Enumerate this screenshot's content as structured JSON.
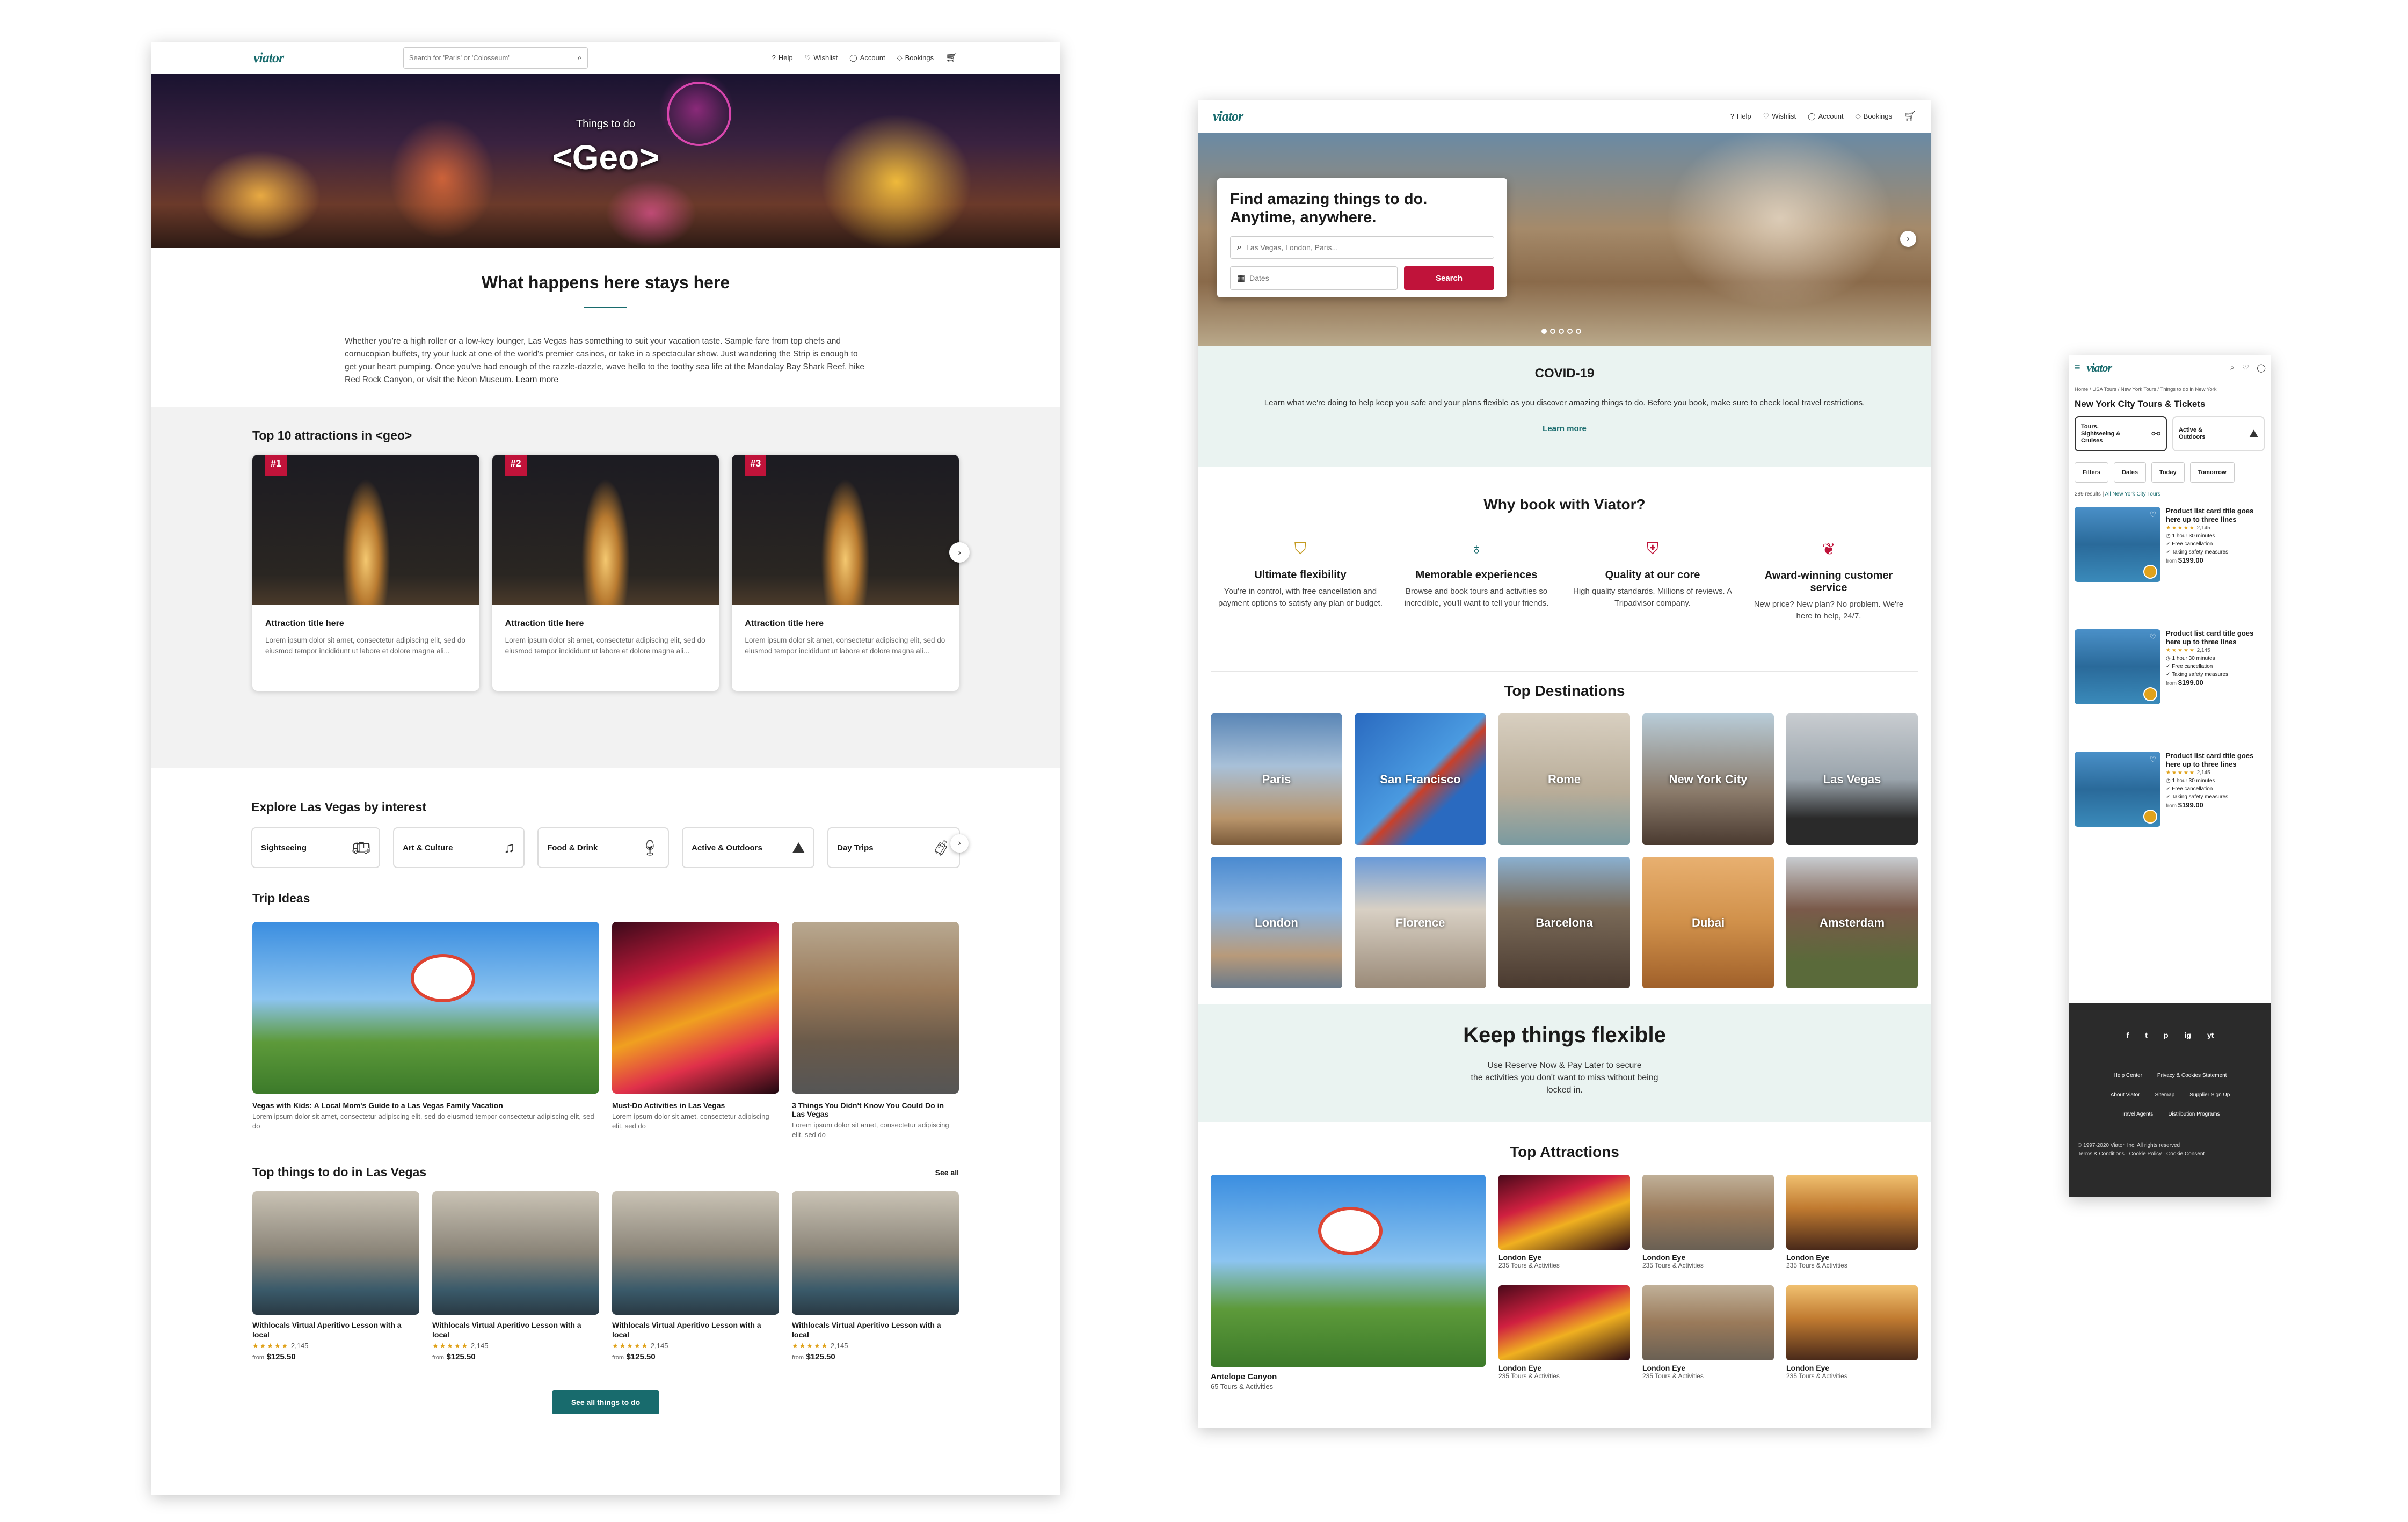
{
  "left": {
    "logo": "viator",
    "search_placeholder": "Search for 'Paris' or 'Colosseum'",
    "nav": {
      "help": "Help",
      "wishlist": "Wishlist",
      "account": "Account",
      "bookings": "Bookings"
    },
    "hero": {
      "eyebrow": "Things to do",
      "title": "<Geo>"
    },
    "intro": {
      "heading": "What happens here stays here",
      "body": "Whether you're a high roller or a low-key lounger, Las Vegas has something to suit your vacation taste. Sample fare from top chefs and cornucopian buffets, try your luck at one of the world's premier casinos, or take in a spectacular show. Just wandering the Strip is enough to get your heart pumping. Once you've had enough of the razzle-dazzle, wave hello to the toothy sea life at the Mandalay Bay Shark Reef, hike Red Rock Canyon, or visit the Neon Museum.",
      "link": "Learn more"
    },
    "top10": {
      "heading": "Top 10 attractions in <geo>",
      "cards": [
        {
          "rank": "#1",
          "title": "Attraction title here",
          "body": "Lorem ipsum dolor sit amet, consectetur adipiscing elit, sed do eiusmod tempor incididunt ut labore et dolore magna ali..."
        },
        {
          "rank": "#2",
          "title": "Attraction title here",
          "body": "Lorem ipsum dolor sit amet, consectetur adipiscing elit, sed do eiusmod tempor incididunt ut labore et dolore magna ali..."
        },
        {
          "rank": "#3",
          "title": "Attraction title here",
          "body": "Lorem ipsum dolor sit amet, consectetur adipiscing elit, sed do eiusmod tempor incididunt ut labore et dolore magna ali..."
        }
      ]
    },
    "explore": {
      "heading": "Explore Las Vegas by interest",
      "items": [
        "Sightseeing",
        "Art & Culture",
        "Food & Drink",
        "Active & Outdoors",
        "Day Trips"
      ]
    },
    "trip_ideas": {
      "heading": "Trip Ideas",
      "items": [
        {
          "title": "Vegas with Kids: A Local Mom's Guide to a Las Vegas Family Vacation",
          "body": "Lorem ipsum dolor sit amet, consectetur adipiscing elit, sed do eiusmod tempor consectetur adipiscing elit, sed do"
        },
        {
          "title": "Must-Do Activities in Las Vegas",
          "body": "Lorem ipsum dolor sit amet, consectetur adipiscing elit, sed do"
        },
        {
          "title": "3 Things You Didn't Know You Could Do in Las Vegas",
          "body": "Lorem ipsum dolor sit amet, consectetur adipiscing elit, sed do"
        }
      ]
    },
    "top_things": {
      "heading": "Top things to do in Las Vegas",
      "see_all": "See all",
      "items": [
        {
          "title": "Withlocals Virtual Aperitivo Lesson with a local",
          "stars": "★★★★★",
          "reviews": "2,145",
          "from": "from",
          "price": "$125.50"
        },
        {
          "title": "Withlocals Virtual Aperitivo Lesson with a local",
          "stars": "★★★★★",
          "reviews": "2,145",
          "from": "from",
          "price": "$125.50"
        },
        {
          "title": "Withlocals Virtual Aperitivo Lesson with a local",
          "stars": "★★★★★",
          "reviews": "2,145",
          "from": "from",
          "price": "$125.50"
        },
        {
          "title": "Withlocals Virtual Aperitivo Lesson with a local",
          "stars": "★★★★★",
          "reviews": "2,145",
          "from": "from",
          "price": "$125.50"
        }
      ]
    },
    "cta": "See all things to do"
  },
  "middle": {
    "logo": "viator",
    "nav": {
      "help": "Help",
      "wishlist": "Wishlist",
      "account": "Account",
      "bookings": "Bookings"
    },
    "hero": {
      "heading_line1": "Find amazing things to do.",
      "heading_line2": "Anytime, anywhere.",
      "location_placeholder": "Las Vegas, London, Paris...",
      "dates_placeholder": "Dates",
      "search_button": "Search"
    },
    "covid": {
      "heading": "COVID-19",
      "body": "Learn what we're doing to help keep you safe and your plans flexible as you discover amazing things to do. Before you book, make sure to check local travel restrictions.",
      "link": "Learn more"
    },
    "why": {
      "heading": "Why book with Viator?",
      "items": [
        {
          "title": "Ultimate flexibility",
          "body": "You're in control, with free cancellation and payment options to satisfy any plan or budget."
        },
        {
          "title": "Memorable experiences",
          "body": "Browse and book tours and activities so incredible, you'll want to tell your friends."
        },
        {
          "title": "Quality at our core",
          "body": "High quality standards. Millions of reviews. A Tripadvisor company."
        },
        {
          "title": "Award-winning customer service",
          "body": "New price? New plan? No problem. We're here to help, 24/7."
        }
      ]
    },
    "destinations": {
      "heading": "Top Destinations",
      "items": [
        "Paris",
        "San Francisco",
        "Rome",
        "New York City",
        "Las Vegas",
        "London",
        "Florence",
        "Barcelona",
        "Dubai",
        "Amsterdam"
      ]
    },
    "flexible": {
      "heading": "Keep things flexible",
      "body_line1": "Use Reserve Now & Pay Later to secure",
      "body_line2": "the activities you don't want to miss without being",
      "body_line3": "locked in."
    },
    "attractions": {
      "heading": "Top Attractions",
      "featured": {
        "title": "Antelope Canyon",
        "sub": "65 Tours & Activities"
      },
      "items": [
        {
          "title": "London Eye",
          "sub": "235 Tours & Activities"
        },
        {
          "title": "London Eye",
          "sub": "235 Tours & Activities"
        },
        {
          "title": "London Eye",
          "sub": "235 Tours & Activities"
        },
        {
          "title": "London Eye",
          "sub": "235 Tours & Activities"
        },
        {
          "title": "London Eye",
          "sub": "235 Tours & Activities"
        },
        {
          "title": "London Eye",
          "sub": "235 Tours & Activities"
        }
      ]
    }
  },
  "right": {
    "logo": "viator",
    "breadcrumb": "Home / USA Tours / New York Tours / Things to do in New York",
    "title": "New York City Tours & Tickets",
    "categories": [
      {
        "label": "Tours, Sightseeing & Cruises"
      },
      {
        "label": "Active & Outdoors"
      }
    ],
    "filters": [
      "Filters",
      "Dates",
      "Today",
      "Tomorrow"
    ],
    "results_count": "289 results",
    "results_link": "All New York City Tours",
    "products": [
      {
        "title": "Product list card title goes here up to three lines",
        "stars": "★★★★★",
        "reviews": "2,145",
        "duration": "1 hour 30 minutes",
        "f1": "Free cancellation",
        "f2": "Taking safety measures",
        "from": "from",
        "price": "$199.00"
      },
      {
        "title": "Product list card title goes here up to three lines",
        "stars": "★★★★★",
        "reviews": "2,145",
        "duration": "1 hour 30 minutes",
        "f1": "Free cancellation",
        "f2": "Taking safety measures",
        "from": "from",
        "price": "$199.00"
      },
      {
        "title": "Product list card title goes here up to three lines",
        "stars": "★★★★★",
        "reviews": "2,145",
        "duration": "1 hour 30 minutes",
        "f1": "Free cancellation",
        "f2": "Taking safety measures",
        "from": "from",
        "price": "$199.00"
      }
    ],
    "footer": {
      "social": [
        "f",
        "t",
        "p",
        "ig",
        "yt"
      ],
      "links_row1": [
        "Help Center",
        "Privacy & Cookies Statement"
      ],
      "links_row2": [
        "About Viator",
        "Sitemap",
        "Supplier Sign Up"
      ],
      "links_row3": [
        "Travel Agents",
        "Distribution Programs"
      ],
      "copyright": "© 1997-2020 Viator, Inc. All rights reserved",
      "legal": "Terms & Conditions · Cookie Policy · Cookie Consent"
    }
  },
  "colors": {
    "teal": "#186b6d",
    "red": "#c0133a",
    "mint": "#eaf3f1",
    "footer": "#2b2b2b"
  }
}
